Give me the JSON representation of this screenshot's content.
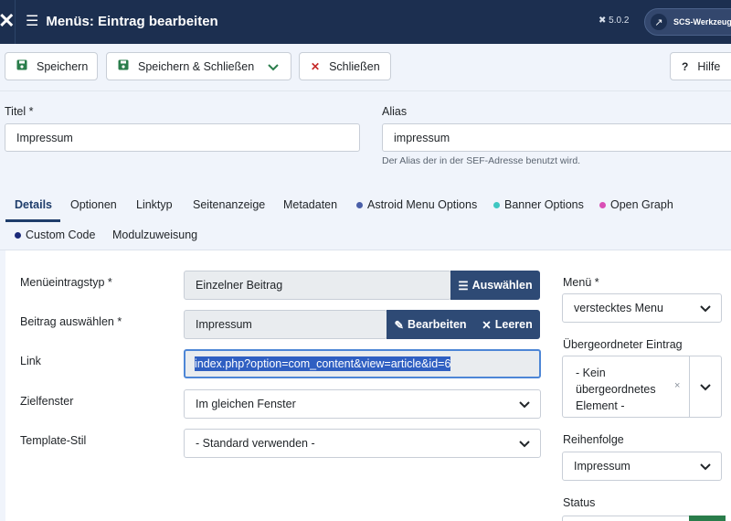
{
  "header": {
    "title": "Menüs: Eintrag bearbeiten",
    "version": "5.0.2",
    "site_button": "SCS-Werkzeugba"
  },
  "toolbar": {
    "save": "Speichern",
    "save_close": "Speichern & Schließen",
    "close": "Schließen",
    "help": "Hilfe"
  },
  "form": {
    "title_label": "Titel *",
    "title_value": "Impressum",
    "alias_label": "Alias",
    "alias_value": "impressum",
    "alias_hint": "Der Alias der in der SEF-Adresse benutzt wird."
  },
  "tabs": [
    {
      "label": "Details"
    },
    {
      "label": "Optionen"
    },
    {
      "label": "Linktyp"
    },
    {
      "label": "Seitenanzeige"
    },
    {
      "label": "Metadaten"
    },
    {
      "label": "Astroid Menu Options",
      "dot": "#4a5fa8"
    },
    {
      "label": "Banner Options",
      "dot": "#3fc7c2"
    },
    {
      "label": "Open Graph",
      "dot": "#d94fb5"
    },
    {
      "label": "Custom Code",
      "dot": "#1b2a7a"
    },
    {
      "label": "Modulzuweisung"
    }
  ],
  "details": {
    "menu_item_type_label": "Menüeintragstyp *",
    "menu_item_type_value": "Einzelner Beitrag",
    "select_button": "Auswählen",
    "article_label": "Beitrag auswählen *",
    "article_value": "Impressum",
    "edit_button": "Bearbeiten",
    "clear_button": "Leeren",
    "link_label": "Link",
    "link_value": "index.php?option=com_content&view=article&id=6",
    "target_label": "Zielfenster",
    "target_value": "Im gleichen Fenster",
    "template_label": "Template-Stil",
    "template_value": "- Standard verwenden -"
  },
  "sidebar": {
    "menu_label": "Menü *",
    "menu_value": "verstecktes Menu",
    "parent_label": "Übergeordneter Eintrag",
    "parent_line1": "- Kein",
    "parent_line2": "übergeordnetes",
    "parent_line3": "Element -",
    "order_label": "Reihenfolge",
    "order_value": "Impressum",
    "status_label": "Status"
  },
  "colors": {
    "header_bg": "#1c2f50",
    "accent": "#2e4a75",
    "save_green": "#2a7d4b",
    "close_red": "#c52827"
  }
}
